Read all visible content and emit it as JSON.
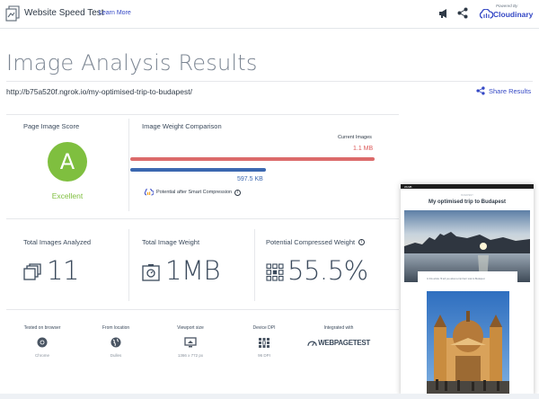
{
  "header": {
    "app_title": "Website Speed Test",
    "learn_more": "Learn More",
    "powered_by": "Powered By",
    "brand": "Cloudinary"
  },
  "page": {
    "title": "Image Analysis Results",
    "url": "http://b75a520f.ngrok.io/my-optimised-trip-to-budapest/",
    "share": "Share Results"
  },
  "score": {
    "label": "Page Image Score",
    "grade": "A",
    "grade_text": "Excellent",
    "grade_color": "#7fbf3f"
  },
  "comparison": {
    "label": "Image Weight Comparison",
    "current_label": "Current Images",
    "current_value": "1.1 MB",
    "optimized_value": "597.5 KB",
    "potential_text": "Potential after Smart Compression",
    "colors": {
      "current": "#dc6b6b",
      "optimized": "#3c68b0"
    }
  },
  "stats": [
    {
      "label": "Total Images Analyzed",
      "value": "11",
      "icon": "images-stack-icon"
    },
    {
      "label": "Total Image Weight",
      "value": "1MB",
      "icon": "weight-scale-icon"
    },
    {
      "label": "Potential Compressed Weight",
      "value": "55.5%",
      "icon": "compression-grid-icon"
    }
  ],
  "environment": [
    {
      "label": "Tested on browser",
      "value": "Chrome",
      "icon": "chrome-icon"
    },
    {
      "label": "From location",
      "value": "Dulles",
      "icon": "globe-location-icon"
    },
    {
      "label": "Viewport size",
      "value": "1366 x 772 px",
      "icon": "monitor-icon"
    },
    {
      "label": "Device DPI",
      "value": "96 DPI",
      "icon": "dpi-grid-icon"
    },
    {
      "label": "Integrated with",
      "value": "WEBPAGETEST",
      "icon": "webpagetest-logo-icon"
    }
  ],
  "preview": {
    "site_brand": "WLMB",
    "kicker": "BUDAPEST",
    "title": "My optimised trip to Budapest",
    "caption": "In this article I'll tell you about a trip that I took to Budapest"
  }
}
